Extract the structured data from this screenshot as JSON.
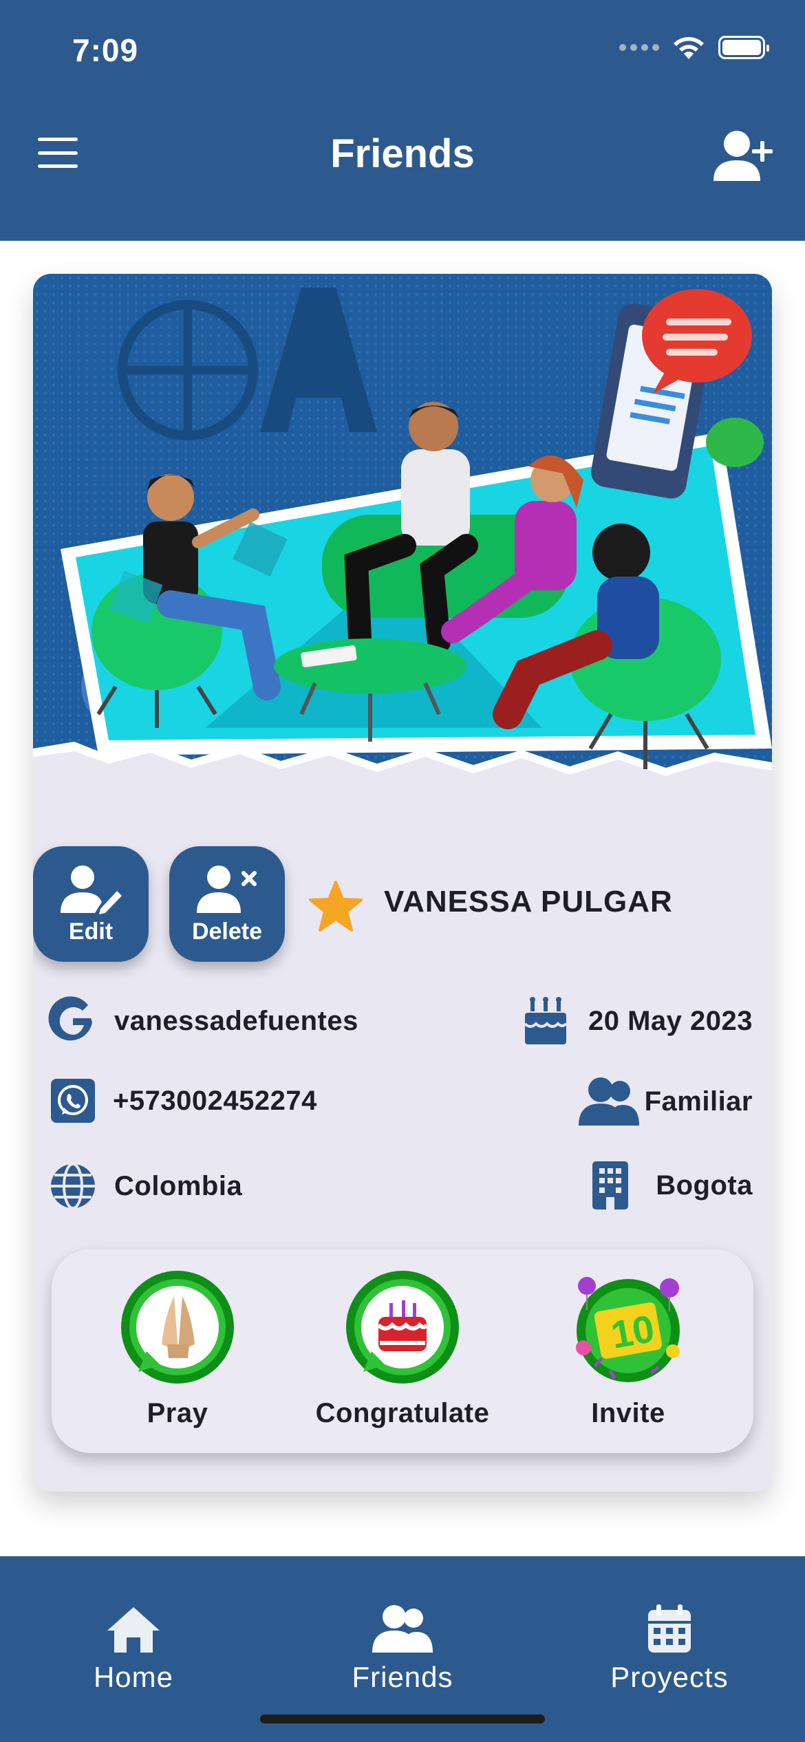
{
  "status_bar": {
    "time": "7:09"
  },
  "header": {
    "title": "Friends"
  },
  "friend": {
    "name": "VANESSA PULGAR",
    "google_user": "vanessadefuentes",
    "birthday": "20 May 2023",
    "phone": "+573002452274",
    "relation": "Familiar",
    "country": "Colombia",
    "city": "Bogota"
  },
  "buttons": {
    "edit_label": "Edit",
    "delete_label": "Delete"
  },
  "actions": [
    {
      "label": "Pray",
      "icon": "praying-hands-icon"
    },
    {
      "label": "Congratulate",
      "icon": "cake-icon"
    },
    {
      "label": "Invite",
      "icon": "party-icon"
    }
  ],
  "nav": [
    {
      "label": "Home",
      "icon": "home-icon"
    },
    {
      "label": "Friends",
      "icon": "users-icon"
    },
    {
      "label": "Proyects",
      "icon": "calendar-icon"
    }
  ],
  "colors": {
    "primary": "#2d5a8e",
    "card": "#e9e7f2",
    "star": "#f5a623",
    "whatsapp_green": "#1aa51a"
  }
}
